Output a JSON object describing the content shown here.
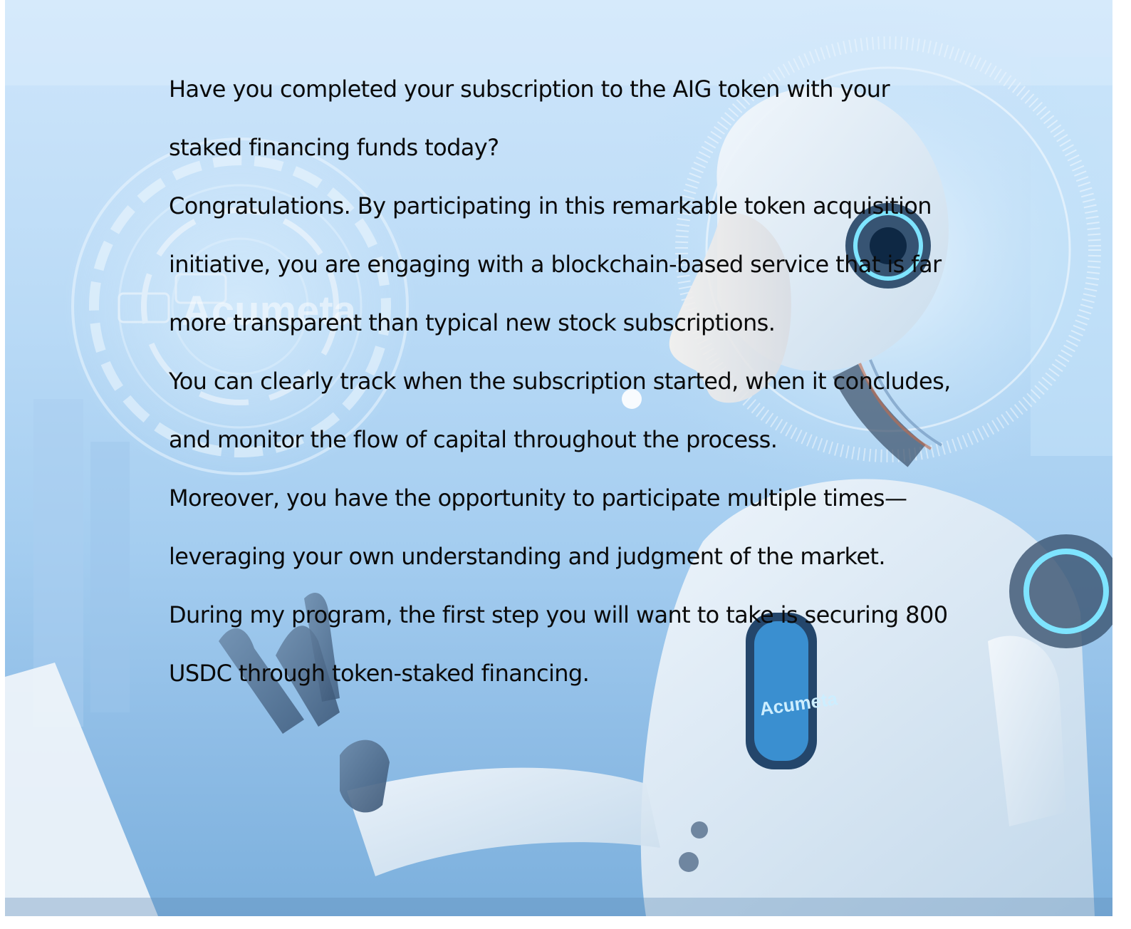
{
  "document": {
    "paragraphs": [
      "Have you completed your subscription to the AIG token with your staked financing funds today?",
      "Congratulations. By participating in this remarkable token acquisition initiative, you are engaging with a blockchain-based service that is far more transparent than typical new stock subscriptions.",
      "You can clearly track when the subscription started, when it concludes, and monitor the flow of capital throughout the process.",
      "Moreover, you have the opportunity to participate multiple times—leveraging your own understanding and judgment of the market.",
      "During my program, the first step you will want to take is securing 800 USDC through token-staked financing."
    ]
  },
  "background": {
    "logo_left": "Acumeta",
    "logo_chest": "Acumeta"
  }
}
